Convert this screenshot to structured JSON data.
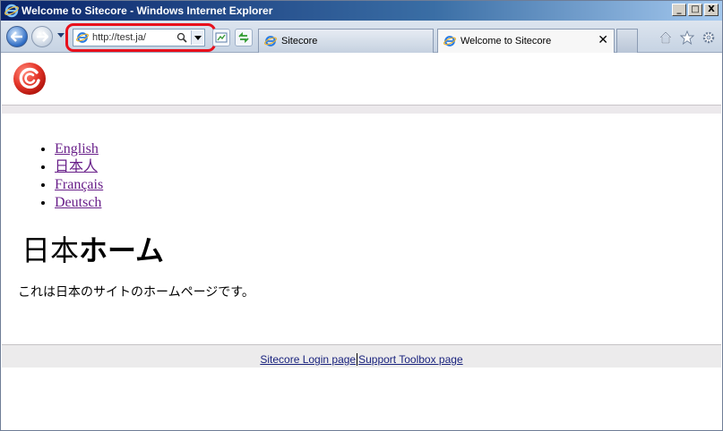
{
  "window": {
    "title": "Welcome to Sitecore - Windows Internet Explorer",
    "controls": {
      "minimize": "_",
      "maximize": "□",
      "close": "X"
    }
  },
  "toolbar": {
    "address": "http://test.ja/",
    "tabs": [
      {
        "label": "Sitecore",
        "active": false
      },
      {
        "label": "Welcome to Sitecore",
        "active": true,
        "close": "✕"
      }
    ]
  },
  "page": {
    "languages": [
      "English",
      "日本人",
      "Français",
      "Deutsch"
    ],
    "heading_normal": "日本",
    "heading_bold": "ホーム",
    "body_text": "これは日本のサイトのホームページです。",
    "footer_links": [
      "Sitecore Login page",
      "Support Toolbox page"
    ]
  },
  "colors": {
    "link_visited": "#681e89",
    "footer_link": "#1a237e",
    "highlight": "#e8101c",
    "sitecore_red": "#e5372b"
  }
}
